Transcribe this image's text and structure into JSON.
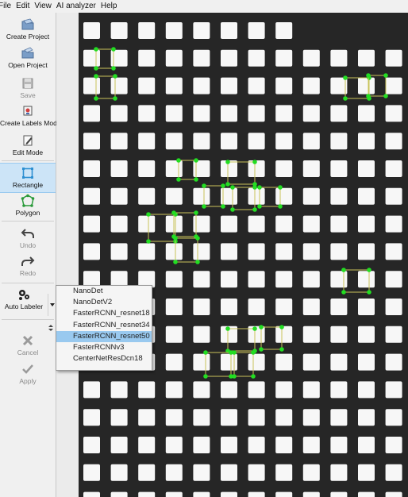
{
  "menu": [
    "File",
    "Edit",
    "View",
    "AI analyzer",
    "Help"
  ],
  "tools": {
    "create_project": "Create Project",
    "open_project": "Open Project",
    "save": "Save",
    "create_labels_mode": "Create Labels Mode",
    "edit_mode": "Edit Mode",
    "rectangle": "Rectangle",
    "polygon": "Polygon",
    "undo": "Undo",
    "redo": "Redo",
    "auto_labeler": "Auto Labeler",
    "cancel": "Cancel",
    "apply": "Apply"
  },
  "model_options": [
    "NanoDet",
    "NanoDetV2",
    "FasterRCNN_resnet18",
    "FasterRCNN_resnet34",
    "FasterRCNN_resnet50",
    "FasterRCNNv3",
    "CenterNetResDcn18"
  ],
  "selected_model": "FasterRCNN_resnet50",
  "colors": {
    "accent": "#99c9ef",
    "label_box": "#c9c35a",
    "label_vertex": "#22dd22",
    "canvas": "#262626"
  }
}
